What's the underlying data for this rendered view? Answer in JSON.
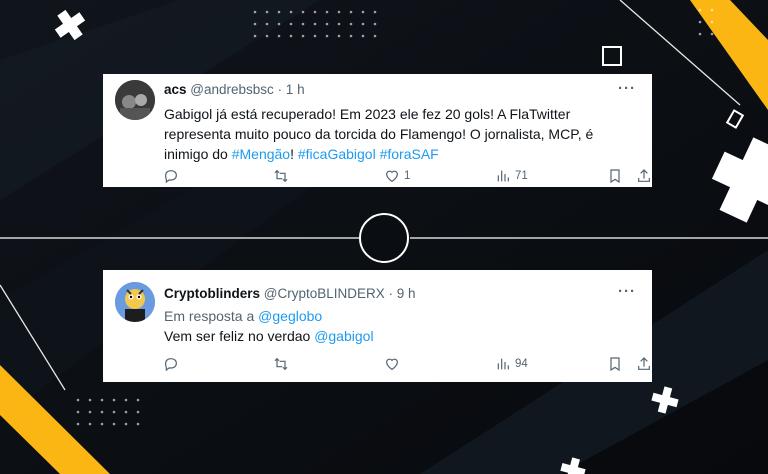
{
  "colors": {
    "background": "#0a0d12",
    "accent_yellow": "#fbb614",
    "link": "#1d9bf0",
    "muted": "#536471"
  },
  "tweets": [
    {
      "name": "acs",
      "handle": "@andrebsbsc",
      "time": "· 1 h",
      "text": "Gabigol já está recuperado! Em 2023 ele fez 20 gols! A FlaTwitter representa muito pouco da torcida do Flamengo! O jornalista, MCP, é inimigo do ",
      "hashtags": [
        "#Mengão",
        "!",
        "#ficaGabigol",
        "#foraSAF"
      ],
      "likes": "1",
      "views": "71"
    },
    {
      "name": "Cryptoblinders",
      "handle": "@CryptoBLINDERX",
      "time": "· 9 h",
      "reply_prefix": "Em resposta a ",
      "reply_to": "@geglobo",
      "text": "Vem ser feliz no verdao ",
      "mention": "@gabigol",
      "views": "94"
    }
  ],
  "icons": [
    "reply-icon",
    "retweet-icon",
    "like-icon",
    "views-icon",
    "bookmark-icon",
    "share-icon",
    "more-icon"
  ]
}
